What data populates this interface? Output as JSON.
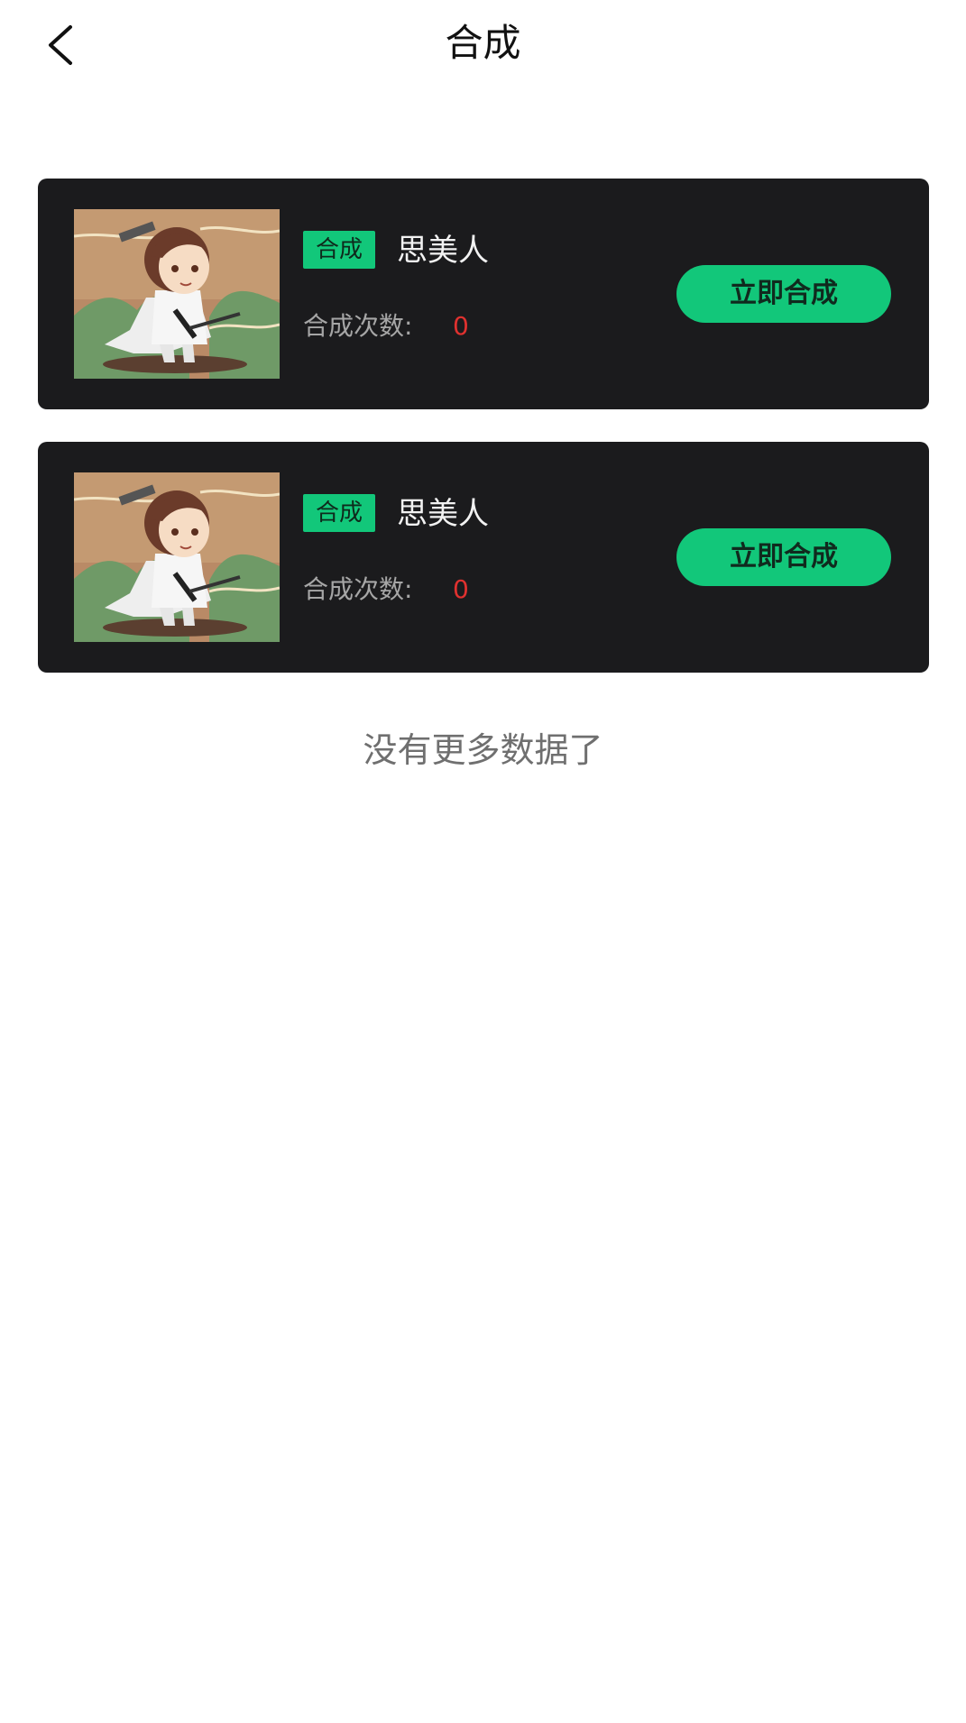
{
  "header": {
    "title": "合成",
    "back_icon": "chevron-left-icon"
  },
  "items": [
    {
      "tag": "合成",
      "name": "思美人",
      "count_label": "合成次数:",
      "count_value": "0",
      "button_label": "立即合成"
    },
    {
      "tag": "合成",
      "name": "思美人",
      "count_label": "合成次数:",
      "count_value": "0",
      "button_label": "立即合成"
    }
  ],
  "footer": {
    "message": "没有更多数据了"
  },
  "colors": {
    "accent": "#12c77a",
    "card_bg": "#1b1b1d",
    "count_value": "#e0312f"
  }
}
